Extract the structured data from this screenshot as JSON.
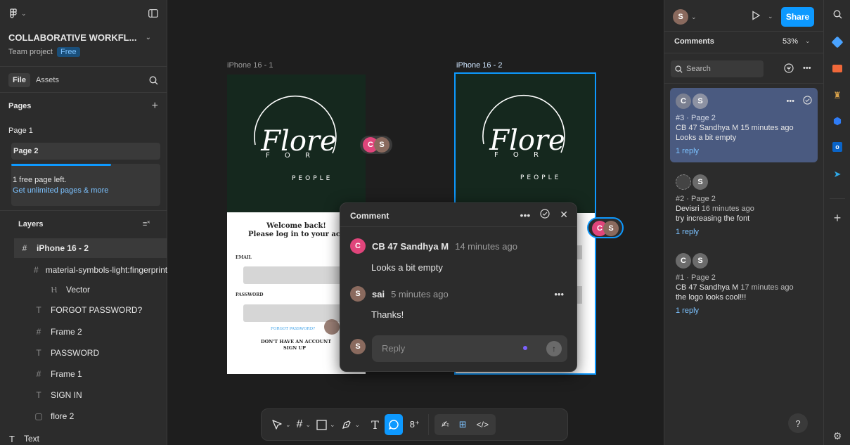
{
  "left": {
    "project_title": "COLLABORATIVE WORKFL...",
    "project_sub": "Team project",
    "plan_badge": "Free",
    "tabs": [
      "File",
      "Assets"
    ],
    "pages_header": "Pages",
    "pages": [
      "Page 1",
      "Page 2"
    ],
    "free_notice": "1 free page left.",
    "upgrade_link": "Get unlimited pages & more",
    "layers_header": "Layers",
    "layers": [
      {
        "name": "iPhone 16 - 2",
        "icon": "frame-icon"
      },
      {
        "name": "material-symbols-light:fingerprint",
        "icon": "frame-icon"
      },
      {
        "name": "Vector",
        "icon": "vector-icon"
      },
      {
        "name": "FORGOT PASSWORD?",
        "icon": "text-icon"
      },
      {
        "name": "Frame 2",
        "icon": "frame-icon"
      },
      {
        "name": "PASSWORD",
        "icon": "text-icon"
      },
      {
        "name": "Frame 1",
        "icon": "frame-icon"
      },
      {
        "name": "SIGN IN",
        "icon": "text-icon"
      },
      {
        "name": "flore 2",
        "icon": "image-icon"
      },
      {
        "name": "Text",
        "icon": "text-icon"
      }
    ]
  },
  "canvas": {
    "frame1_label": "iPhone 16 - 1",
    "frame2_label": "iPhone 16 - 2",
    "logo_word": "Flore",
    "logo_ring": "FOR PEOPLE",
    "welcome": "Welcome back!",
    "login_line": "Please log in to your accoun",
    "email_label": "EMAIL",
    "password_label": "PASSWORD",
    "forgot": "FORGOT PASSWORD?",
    "no_account": "DON'T HAVE AN ACCOUNT",
    "sign_up": "SIGN UP"
  },
  "popup": {
    "title": "Comment",
    "c1_author": "CB 47 Sandhya M",
    "c1_time": "14 minutes ago",
    "c1_text": "Looks a bit empty",
    "c2_author": "sai",
    "c2_time": "5 minutes ago",
    "c2_text": "Thanks!",
    "reply_placeholder": "Reply",
    "avatar_c": "C",
    "avatar_s": "S"
  },
  "right": {
    "user_initial": "S",
    "share_label": "Share",
    "panel_title": "Comments",
    "zoom": "53%",
    "search_placeholder": "Search",
    "comments": [
      {
        "ref": "#3 · Page 2",
        "author": "CB 47 Sandhya M",
        "time": "15 minutes ago",
        "text": "Looks a bit empty",
        "replies": "1 reply"
      },
      {
        "ref": "#2 · Page 2",
        "author": "Devisri",
        "time": "16 minutes ago",
        "text": "try increasing the font",
        "replies": "1 reply"
      },
      {
        "ref": "#1 · Page 2",
        "author": "CB 47 Sandhya M",
        "time": "17 minutes ago",
        "text": "the logo looks cool!!!",
        "replies": "1 reply"
      }
    ],
    "help": "?"
  },
  "colors": {
    "accent": "#0d99ff",
    "panel": "#2c2c2c",
    "canvas": "#1e1e1e",
    "logo_bg": "#15281e",
    "selected_card": "#4a5a80",
    "avatar_c": "#e0457b",
    "avatar_s": "#8a6a5e"
  }
}
